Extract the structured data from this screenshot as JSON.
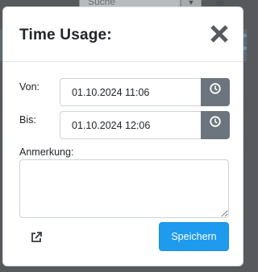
{
  "background": {
    "search_placeholder": "Suche"
  },
  "modal": {
    "title": "Time Usage:",
    "von_label": "Von:",
    "von_value": "01.10.2024 11:06",
    "bis_label": "Bis:",
    "bis_value": "01.10.2024 12:06",
    "note_label": "Anmerkung:",
    "note_value": "",
    "save_label": "Speichern"
  },
  "icons": {
    "close": "close-icon",
    "clock": "clock-icon",
    "external_link": "external-link-icon",
    "resize_grip": "resize-grip-icon"
  },
  "colors": {
    "primary": "#1e9aee",
    "secondary": "#6c757d",
    "overlay": "#58595c"
  }
}
